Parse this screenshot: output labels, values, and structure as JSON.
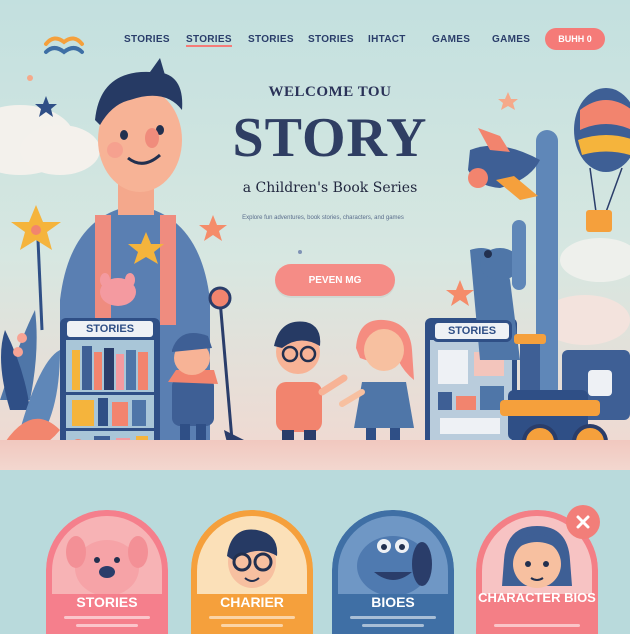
{
  "nav": {
    "items": [
      "STORIES",
      "STORIES",
      "STORIES",
      "STORIES",
      "IHTACT",
      "GAMES",
      "GAMES"
    ],
    "button_label": "BUHH 0"
  },
  "hero": {
    "welcome": "WELCOME TOU",
    "title": "STORY",
    "subtitle": "a Children's Book Series",
    "description": "Explore fun adventures, book stories, characters, and games",
    "cta_label": "PEVEN MG",
    "sign_left": "STORIES",
    "sign_right": "STORIES"
  },
  "cards": [
    {
      "label": "STORIES",
      "color": "#f57f8c"
    },
    {
      "label": "CHARIER",
      "color": "#f5a03c"
    },
    {
      "label": "BIOES",
      "color": "#3f6fa5"
    },
    {
      "label": "CHARACTER BIOS",
      "color": "#f47f86"
    }
  ],
  "colors": {
    "accent": "#f57b78",
    "navy": "#2f3e63"
  },
  "icons": {
    "logo": "wave-logo-icon",
    "close": "close-icon"
  }
}
